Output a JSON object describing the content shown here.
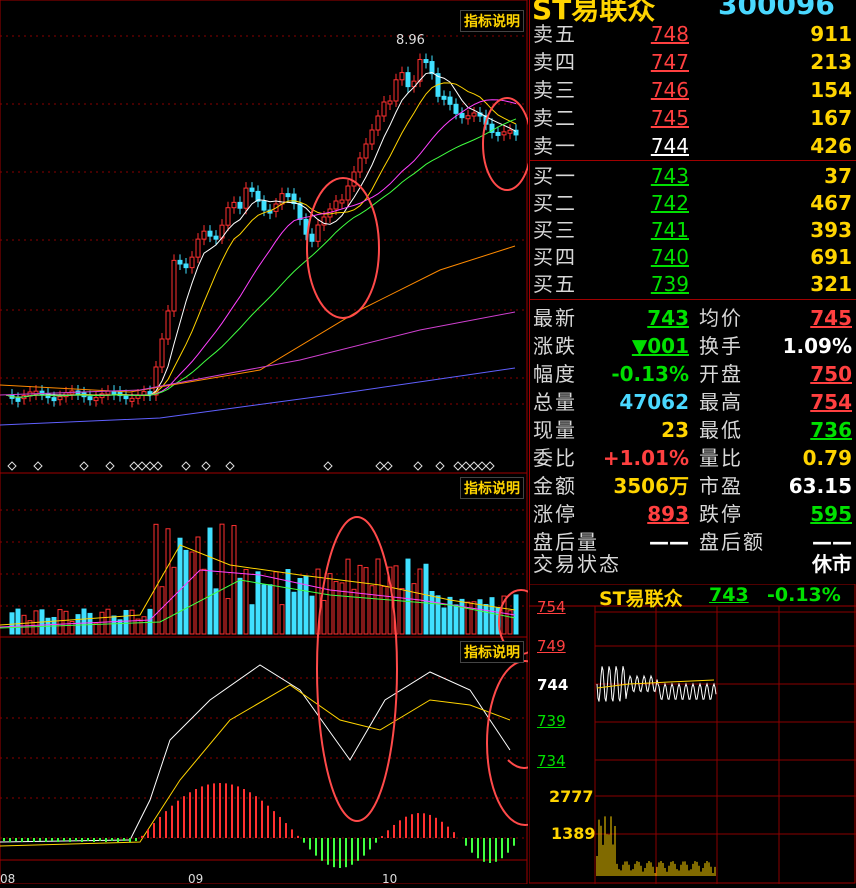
{
  "header": {
    "name": "ST易联众",
    "code": "300096"
  },
  "panels": {
    "main_label": "指标说明",
    "volume_label": "指标说明",
    "macd_label": "指标说明",
    "peak_price": "8.96",
    "bottom_axis": [
      "08",
      "09",
      "10"
    ]
  },
  "order_book": {
    "asks": [
      {
        "label": "卖五",
        "price": "748",
        "volume": "911"
      },
      {
        "label": "卖四",
        "price": "747",
        "volume": "213"
      },
      {
        "label": "卖三",
        "price": "746",
        "volume": "154"
      },
      {
        "label": "卖二",
        "price": "745",
        "volume": "167"
      },
      {
        "label": "卖一",
        "price": "744",
        "volume": "426"
      }
    ],
    "bids": [
      {
        "label": "买一",
        "price": "743",
        "volume": "37"
      },
      {
        "label": "买二",
        "price": "742",
        "volume": "467"
      },
      {
        "label": "买三",
        "price": "741",
        "volume": "393"
      },
      {
        "label": "买四",
        "price": "740",
        "volume": "691"
      },
      {
        "label": "买五",
        "price": "739",
        "volume": "321"
      }
    ]
  },
  "stats": {
    "left": [
      {
        "label": "最新",
        "value": "743"
      },
      {
        "label": "涨跌",
        "value": "▼001"
      },
      {
        "label": "幅度",
        "value": "-0.13%"
      },
      {
        "label": "总量",
        "value": "47062"
      },
      {
        "label": "现量",
        "value": "23"
      },
      {
        "label": "委比",
        "value": "+1.01%"
      },
      {
        "label": "金额",
        "value": "3506万"
      },
      {
        "label": "涨停",
        "value": "893"
      },
      {
        "label": "盘后量",
        "value": "——"
      },
      {
        "label": "交易状态",
        "value": ""
      }
    ],
    "right": [
      {
        "label": "均价",
        "value": "745"
      },
      {
        "label": "换手",
        "value": "1.09%"
      },
      {
        "label": "开盘",
        "value": "750"
      },
      {
        "label": "最高",
        "value": "754"
      },
      {
        "label": "最低",
        "value": "736"
      },
      {
        "label": "量比",
        "value": "0.79"
      },
      {
        "label": "市盈",
        "value": "63.15"
      },
      {
        "label": "跌停",
        "value": "595"
      },
      {
        "label": "盘后额",
        "value": "——"
      },
      {
        "label": "",
        "value": "休市"
      }
    ]
  },
  "mini_chart": {
    "title_name": "ST易联众",
    "title_price": "743",
    "title_change": "-0.13%",
    "price_ticks": [
      "754",
      "749",
      "744",
      "739",
      "734"
    ],
    "volume_ticks": [
      "2777",
      "1389"
    ]
  },
  "colors": {
    "up": "#ff3030",
    "down": "#40e0ff",
    "grid": "#8a0000",
    "annotation": "#ff4a4a"
  }
}
